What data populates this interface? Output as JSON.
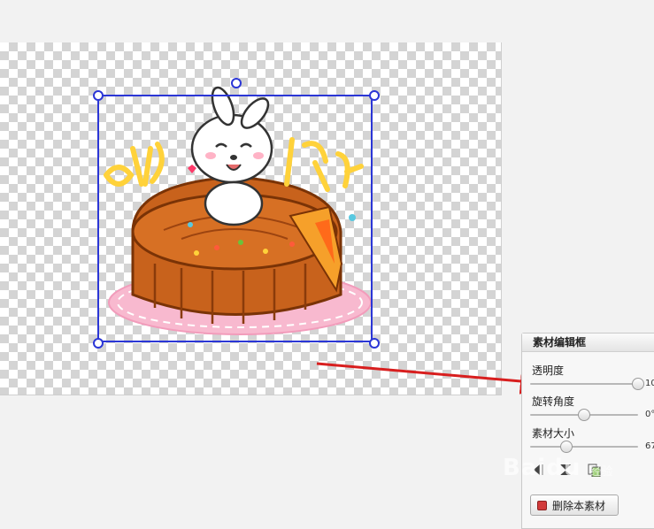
{
  "canvas": {
    "sticker_text_left": "中秋",
    "sticker_text_right": "快乐"
  },
  "panel": {
    "title": "素材编辑框",
    "opacity": {
      "label": "透明度",
      "value": "10",
      "level": 1.0
    },
    "rotation": {
      "label": "旋转角度",
      "value": "0°",
      "level": 0.5
    },
    "size": {
      "label": "素材大小",
      "value": "67",
      "level": 0.34
    },
    "delete_button": "删除本素材"
  },
  "watermark": {
    "brand": "Baidu",
    "sub": "经验"
  },
  "colors": {
    "selection": "#2b36d6",
    "arrow": "#d81e1e",
    "cake": "#c8621c"
  }
}
